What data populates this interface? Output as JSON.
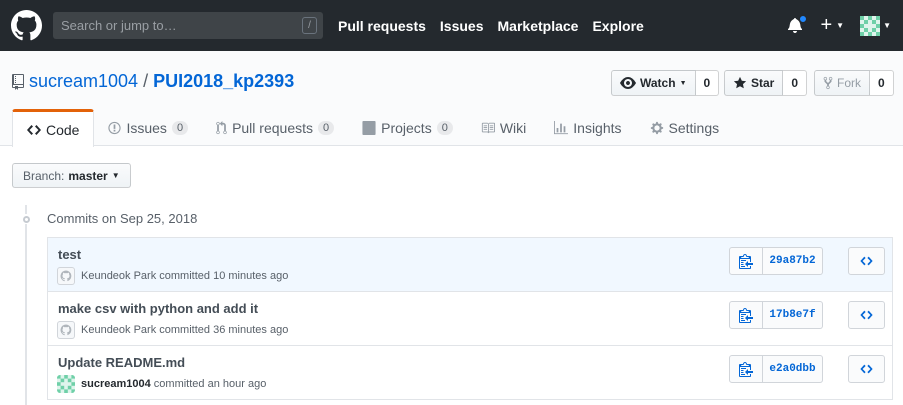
{
  "nav": {
    "search_placeholder": "Search or jump to…",
    "search_key": "/",
    "links": [
      "Pull requests",
      "Issues",
      "Marketplace",
      "Explore"
    ],
    "plus": "+"
  },
  "repo": {
    "owner": "sucream1004",
    "separator": "/",
    "name": "PUI2018_kp2393"
  },
  "actions": {
    "watch_label": "Watch",
    "watch_count": "0",
    "star_label": "Star",
    "star_count": "0",
    "fork_label": "Fork",
    "fork_count": "0"
  },
  "tabs": [
    {
      "label": "Code",
      "icon": "code-icon"
    },
    {
      "label": "Issues",
      "count": "0",
      "icon": "issue-icon"
    },
    {
      "label": "Pull requests",
      "count": "0",
      "icon": "pull-request-icon"
    },
    {
      "label": "Projects",
      "count": "0",
      "icon": "project-icon"
    },
    {
      "label": "Wiki",
      "icon": "book-icon"
    },
    {
      "label": "Insights",
      "icon": "graph-icon"
    },
    {
      "label": "Settings",
      "icon": "gear-icon"
    }
  ],
  "branch": {
    "prefix": "Branch:",
    "name": "master"
  },
  "commits_title": "Commits on Sep 25, 2018",
  "commits": [
    {
      "message": "test",
      "author": "Keundeok Park",
      "action": "committed",
      "time": "10 minutes ago",
      "sha": "29a87b2"
    },
    {
      "message": "make csv with python and add it",
      "author": "Keundeok Park",
      "action": "committed",
      "time": "36 minutes ago",
      "sha": "17b8e7f"
    },
    {
      "message": "Update README.md",
      "author": "sucream1004",
      "action": "committed",
      "time": "an hour ago",
      "sha": "e2a0dbb"
    }
  ],
  "colors": {
    "accent": "#0366d6",
    "tab_active_border": "#e36209",
    "topbar": "#24292e",
    "notification_dot": "#2188ff"
  }
}
